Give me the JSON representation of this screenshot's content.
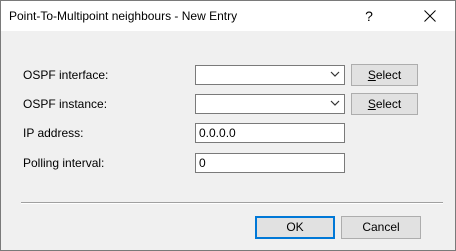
{
  "window": {
    "title": "Point-To-Multipoint neighbours - New Entry",
    "help_glyph": "?",
    "close_glyph": "close-icon"
  },
  "form": {
    "ospf_interface": {
      "label": "OSPF interface:",
      "value": "",
      "button_label": "Select",
      "button_hotkey_index": 0
    },
    "ospf_instance": {
      "label": "OSPF instance:",
      "value": "",
      "button_label": "Select",
      "button_hotkey_index": 0
    },
    "ip_address": {
      "label": "IP address:",
      "value": "0.0.0.0"
    },
    "polling_interval": {
      "label": "Polling interval:",
      "value": "0"
    }
  },
  "buttons": {
    "ok_label": "OK",
    "cancel_label": "Cancel"
  },
  "colors": {
    "panel_bg": "#f0f0f0",
    "default_button_border": "#0078d7"
  }
}
